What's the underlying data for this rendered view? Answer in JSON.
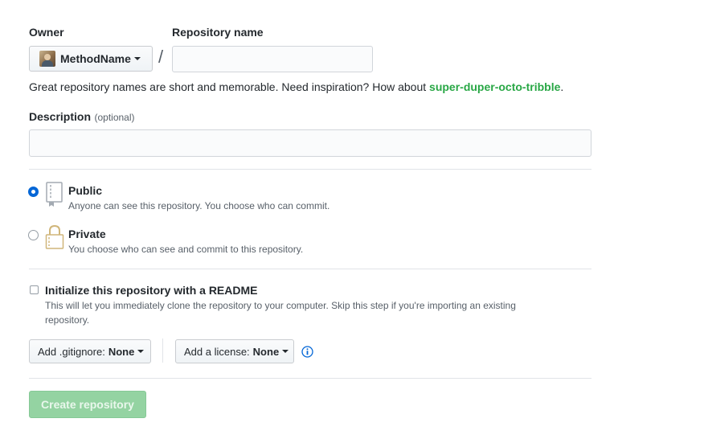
{
  "owner": {
    "label": "Owner",
    "selected": "MethodName",
    "separator": "/"
  },
  "repo_name": {
    "label": "Repository name",
    "value": "",
    "placeholder": ""
  },
  "suggestion": {
    "text": "Great repository names are short and memorable. Need inspiration? How about ",
    "name": "super-duper-octo-tribble",
    "end": "."
  },
  "description": {
    "label": "Description",
    "optional": "(optional)",
    "value": ""
  },
  "visibility": {
    "options": [
      {
        "title": "Public",
        "desc": "Anyone can see this repository. You choose who can commit.",
        "checked": true,
        "icon": "repo-book-icon"
      },
      {
        "title": "Private",
        "desc": "You choose who can see and commit to this repository.",
        "checked": false,
        "icon": "lock-icon"
      }
    ]
  },
  "init": {
    "label": "Initialize this repository with a README",
    "desc_line1": "This will let you immediately clone the repository to your computer. Skip this step if you're importing an existing",
    "desc_line2": "repository.",
    "checked": false
  },
  "gitignore": {
    "prefix": "Add .gitignore:",
    "value": "None"
  },
  "license": {
    "prefix": "Add a license:",
    "value": "None"
  },
  "submit": {
    "label": "Create repository",
    "enabled": false
  },
  "colors": {
    "suggestion": "#28a745",
    "radio_checked": "#0366d6",
    "submit_bg": "#94d3a2",
    "info": "#0366d6"
  }
}
